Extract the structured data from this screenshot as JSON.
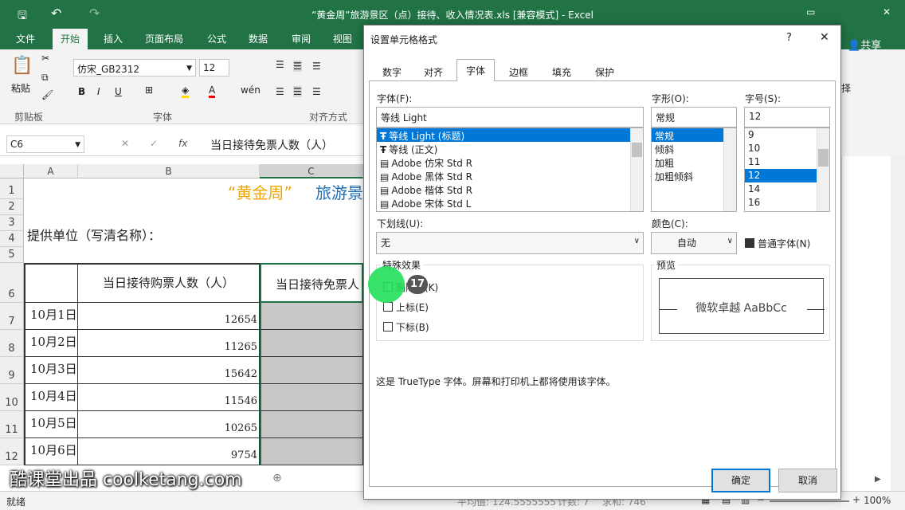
{
  "window": {
    "title": "“黄金周”旅游景区（点）接待、收入情况表.xls  [兼容模式] - Excel",
    "share": "共享",
    "right_fragment": "择"
  },
  "ribbon_tabs": [
    "文件",
    "开始",
    "插入",
    "页面布局",
    "公式",
    "数据",
    "审阅",
    "视图"
  ],
  "ribbon": {
    "paste": "粘贴",
    "clipboard": "剪贴板",
    "font_name": "仿宋_GB2312",
    "font_size": "12",
    "font_group": "字体",
    "align_group": "对齐方式",
    "bold": "B",
    "italic": "I",
    "underline": "U"
  },
  "formula_bar": {
    "cell_ref": "C6",
    "fx": "fx",
    "content": "当日接待免票人数（人）"
  },
  "sheet": {
    "columns": [
      "A",
      "B",
      "C"
    ],
    "title_left": "“黄金周”",
    "title_right": "旅游景",
    "provider": "提供单位（写清名称）：",
    "header_b": "当日接待购票人数（人）",
    "header_c": "当日接待免票人",
    "rows": [
      {
        "num": "7",
        "date": "10月1日",
        "value": "12654"
      },
      {
        "num": "8",
        "date": "10月2日",
        "value": "11265"
      },
      {
        "num": "9",
        "date": "10月3日",
        "value": "15642"
      },
      {
        "num": "10",
        "date": "10月4日",
        "value": "11546"
      },
      {
        "num": "11",
        "date": "10月5日",
        "value": "10265"
      },
      {
        "num": "12",
        "date": "10月6日",
        "value": "9754"
      }
    ],
    "row_labels_top": [
      "1",
      "2",
      "3",
      "4",
      "5",
      "6"
    ]
  },
  "status": {
    "ready": "就绪",
    "partial1": "平均值: 124.5555555",
    "partial2": "计数: 7",
    "partial3": "求和: 746",
    "zoom": "100%"
  },
  "watermark": "酷课堂出品 coolketang.com",
  "dialog": {
    "title": "设置单元格格式",
    "help": "?",
    "close": "✕",
    "tabs": [
      "数字",
      "对齐",
      "字体",
      "边框",
      "填充",
      "保护"
    ],
    "font_label": "字体(F):",
    "font_value": "等线 Light",
    "font_list": [
      "等线 Light (标题)",
      "等线 (正文)",
      "Adobe 仿宋 Std R",
      "Adobe 黑体 Std R",
      "Adobe 楷体 Std R",
      "Adobe 宋体 Std L"
    ],
    "style_label": "字形(O):",
    "style_value": "常规",
    "style_list": [
      "常规",
      "倾斜",
      "加粗",
      "加粗倾斜"
    ],
    "size_label": "字号(S):",
    "size_value": "12",
    "size_list": [
      "9",
      "10",
      "11",
      "12",
      "14",
      "16"
    ],
    "underline_label": "下划线(U):",
    "underline_value": "无",
    "color_label": "颜色(C):",
    "color_value": "自动",
    "normal_font": "普通字体(N)",
    "effects_label": "特殊效果",
    "strike": "删除线(K)",
    "superscript": "上标(E)",
    "subscript": "下标(B)",
    "preview_label": "预览",
    "preview_text": "微软卓越  AaBbCc",
    "info": "这是 TrueType 字体。屏幕和打印机上都将使用该字体。",
    "ok": "确定",
    "cancel": "取消"
  },
  "cursor_badge": "17",
  "colors": {
    "excel_green": "#217346",
    "select_blue": "#0078d7",
    "cursor_green": "#22e05a",
    "title_orange": "#f0a500",
    "title_blue": "#1f6fb5"
  }
}
